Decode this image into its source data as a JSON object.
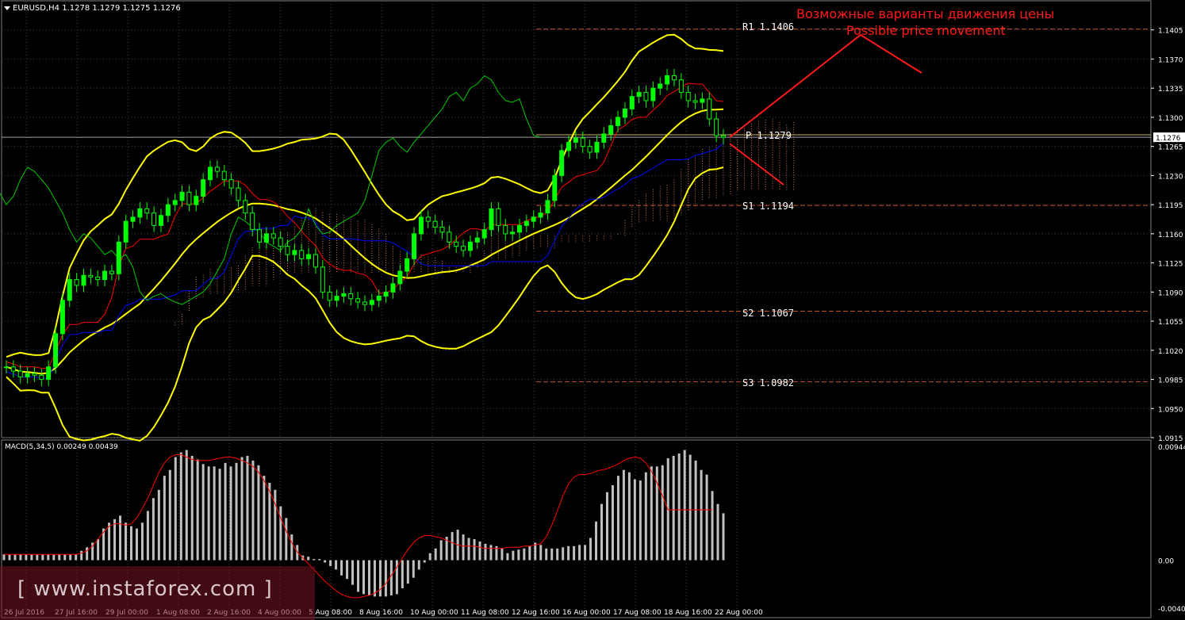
{
  "header": {
    "symbol_line": "EURUSD,H4  1.1278 1.1279 1.1275 1.1276",
    "macd_line": "MACD(5,34,5) 0.00249 0.00439"
  },
  "annotations": {
    "ru": "Возможные варианты движения цены",
    "en": "Possible price movement"
  },
  "watermark": "[ www.instaforex.com ]",
  "colors": {
    "background": "#000000",
    "candle": "#00ff00",
    "bollinger": "#ffff00",
    "tenkan": "#ff0000",
    "kijun": "#0000ff",
    "chikou": "#00cc00",
    "kumo": "#ff9966",
    "macd_hist": "#c0c0c0",
    "macd_signal": "#ff0000",
    "forecast": "#ff1a1a",
    "grid": "#404040",
    "level": "#a04020"
  },
  "chart_data": {
    "type": "line",
    "title": "EURUSD,H4",
    "y_range": [
      1.0915,
      1.144
    ],
    "y_ticks": [
      "1.1405",
      "1.1370",
      "1.1335",
      "1.1300",
      "1.1265",
      "1.1230",
      "1.1195",
      "1.1160",
      "1.1125",
      "1.1090",
      "1.1055",
      "1.1020",
      "1.0985",
      "1.0950",
      "1.0915"
    ],
    "current_price": "1.1276",
    "x_ticks": [
      "26 Jul 2016",
      "27 Jul 16:00",
      "29 Jul 00:00",
      "1 Aug 08:00",
      "2 Aug 16:00",
      "4 Aug 00:00",
      "5 Aug 08:00",
      "8 Aug 16:00",
      "10 Aug 00:00",
      "11 Aug 08:00",
      "12 Aug 16:00",
      "16 Aug 00:00",
      "17 Aug 08:00",
      "18 Aug 16:00",
      "22 Aug 00:00"
    ],
    "pivot_levels": [
      {
        "label": "R1  1.1406",
        "value": 1.1406
      },
      {
        "label": "P  1.1279",
        "value": 1.1279
      },
      {
        "label": "S1  1.1194",
        "value": 1.1194
      },
      {
        "label": "S2  1.1067",
        "value": 1.1067
      },
      {
        "label": "S3  1.0982",
        "value": 1.0982
      }
    ],
    "close_series": [
      1.1,
      1.0995,
      1.0988,
      1.0992,
      1.099,
      1.0985,
      1.1,
      1.104,
      1.108,
      1.1105,
      1.1098,
      1.111,
      1.1108,
      1.1105,
      1.1115,
      1.1112,
      1.115,
      1.1175,
      1.118,
      1.119,
      1.1185,
      1.117,
      1.1182,
      1.1195,
      1.12,
      1.121,
      1.1195,
      1.1205,
      1.1225,
      1.124,
      1.1235,
      1.1225,
      1.1215,
      1.12,
      1.1185,
      1.1165,
      1.115,
      1.116,
      1.1155,
      1.1145,
      1.1135,
      1.114,
      1.113,
      1.1135,
      1.112,
      1.109,
      1.108,
      1.1085,
      1.1088,
      1.1082,
      1.1078,
      1.1075,
      1.108,
      1.1085,
      1.109,
      1.11,
      1.1115,
      1.113,
      1.116,
      1.118,
      1.1175,
      1.1168,
      1.1162,
      1.115,
      1.1145,
      1.114,
      1.115,
      1.1155,
      1.1165,
      1.119,
      1.117,
      1.116,
      1.1162,
      1.117,
      1.1175,
      1.118,
      1.1185,
      1.12,
      1.123,
      1.126,
      1.127,
      1.1275,
      1.1265,
      1.1258,
      1.127,
      1.128,
      1.129,
      1.13,
      1.131,
      1.1325,
      1.133,
      1.132,
      1.1335,
      1.134,
      1.135,
      1.1345,
      1.133,
      1.132,
      1.1318,
      1.1322,
      1.1298,
      1.1278,
      1.1276
    ],
    "macd": {
      "y_range": [
        -0.00402,
        0.00944
      ],
      "y_ticks": [
        "0.00944",
        "0.00",
        "-0.00402"
      ],
      "histogram": [
        0.0005,
        0.0005,
        0.0005,
        0.0005,
        0.0005,
        0.0005,
        0.0005,
        0.0005,
        0.0005,
        0.0005,
        0.0005,
        0.0005,
        0.0005,
        0.0005,
        0.0008,
        0.0011,
        0.0015,
        0.0018,
        0.0027,
        0.0032,
        0.0035,
        0.0038,
        0.0032,
        0.0029,
        0.0027,
        0.0032,
        0.0042,
        0.0053,
        0.006,
        0.0072,
        0.0077,
        0.0088,
        0.0092,
        0.0094,
        0.0089,
        0.0086,
        0.0082,
        0.008,
        0.008,
        0.0078,
        0.0083,
        0.008,
        0.0083,
        0.0088,
        0.0089,
        0.0085,
        0.0081,
        0.0072,
        0.0066,
        0.006,
        0.0046,
        0.0036,
        0.0022,
        0.0013,
        0.0004,
        0.0003,
        0.0001,
        0.0001,
        -0.0002,
        -0.0005,
        -0.0008,
        -0.0013,
        -0.0016,
        -0.0021,
        -0.0027,
        -0.0029,
        -0.003,
        -0.0031,
        -0.0031,
        -0.0031,
        -0.003,
        -0.0029,
        -0.0024,
        -0.002,
        -0.0015,
        -0.0008,
        -0.0002,
        0.0006,
        0.001,
        0.0017,
        0.002,
        0.0024,
        0.0026,
        0.0022,
        0.0019,
        0.0018,
        0.0016,
        0.0014,
        0.0013,
        0.0012,
        0.001,
        0.0006,
        0.0008,
        0.0009,
        0.001,
        0.0012,
        0.0015,
        0.0013,
        0.001,
        0.001,
        0.001,
        0.0011,
        0.0012,
        0.0012,
        0.0013,
        0.0013,
        0.0019,
        0.0033,
        0.0048,
        0.0058,
        0.0064,
        0.0072,
        0.0077,
        0.0075,
        0.0069,
        0.0068,
        0.0075,
        0.008,
        0.008,
        0.0081,
        0.0087,
        0.0089,
        0.0091,
        0.0094,
        0.009,
        0.0085,
        0.0077,
        0.0073,
        0.0059,
        0.0048,
        0.004
      ],
      "signal": [
        0.0005,
        0.0005,
        0.0005,
        0.0005,
        0.0005,
        0.0005,
        0.0005,
        0.0005,
        0.0005,
        0.0005,
        0.0005,
        0.0005,
        0.0005,
        0.0005,
        0.0006,
        0.0008,
        0.0012,
        0.0018,
        0.0024,
        0.0029,
        0.0031,
        0.0031,
        0.003,
        0.0031,
        0.0036,
        0.0044,
        0.0053,
        0.0064,
        0.0075,
        0.0083,
        0.0088,
        0.009,
        0.009,
        0.0088,
        0.0086,
        0.0085,
        0.0085,
        0.0085,
        0.0086,
        0.0087,
        0.0088,
        0.0088,
        0.0087,
        0.0085,
        0.0083,
        0.008,
        0.0075,
        0.0068,
        0.0059,
        0.0048,
        0.0036,
        0.0025,
        0.0015,
        0.0007,
        0.0002,
        -0.0003,
        -0.0008,
        -0.0013,
        -0.0018,
        -0.0022,
        -0.0026,
        -0.0029,
        -0.0031,
        -0.0032,
        -0.0032,
        -0.0031,
        -0.003,
        -0.0028,
        -0.0025,
        -0.002,
        -0.0013,
        -0.0006,
        0.0002,
        0.0009,
        0.0015,
        0.0019,
        0.0021,
        0.0021,
        0.002,
        0.0019,
        0.0017,
        0.0015,
        0.0013,
        0.0012,
        0.0012,
        0.0012,
        0.0011,
        0.001,
        0.001,
        0.001,
        0.001,
        0.0011,
        0.0011,
        0.0011,
        0.0012,
        0.0012,
        0.0013,
        0.0014,
        0.002,
        0.003,
        0.0042,
        0.0055,
        0.0065,
        0.0071,
        0.0073,
        0.0073,
        0.0074,
        0.0076,
        0.0077,
        0.0078,
        0.008,
        0.0082,
        0.0085,
        0.0087,
        0.0088,
        0.0087,
        0.0083,
        0.0076,
        0.0066,
        0.0055,
        0.0043,
        0.0043,
        0.0043,
        0.0043,
        0.0043,
        0.0043,
        0.0043,
        0.0043,
        0.0043
      ]
    }
  }
}
